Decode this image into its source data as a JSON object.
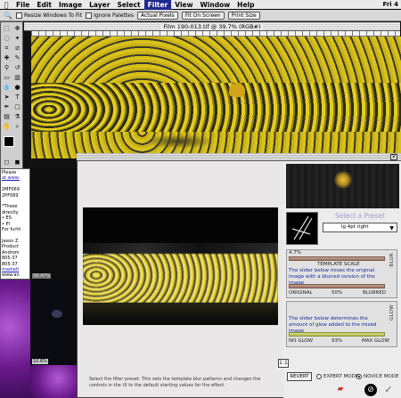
{
  "menubar": {
    "apple": "",
    "items": [
      "File",
      "Edit",
      "Image",
      "Layer",
      "Select",
      "Filter",
      "View",
      "Window",
      "Help"
    ],
    "active_index": 5,
    "clock": "Fri 4"
  },
  "options_bar": {
    "resize_windows": "Resize Windows To Fit",
    "ignore_palettes": "Ignore Palettes",
    "actual_pixels": "Actual Pixels",
    "fit_on_screen": "Fit On Screen",
    "print_size": "Print Size"
  },
  "document": {
    "title": "Film 190-013.tif @ 39.7% (RGB#)"
  },
  "left_window": {
    "lines": [
      "Please",
      "at www.",
      "",
      "2MF069",
      "2PF069",
      "",
      "*These",
      "directly",
      "• ES",
      "• Pl",
      "For furth",
      "",
      "Jason Z",
      "Product",
      "Androm",
      "805-37",
      "805-37",
      "marketi",
      "www.an"
    ],
    "zoom1": "39.47%",
    "zoom2": "10.6%"
  },
  "dialog": {
    "close": "✕",
    "preset_title": "Select a Preset",
    "preset_value": "lg 4pt right",
    "template_scale_value": "4.7%",
    "template_scale_label": "TEMPLATE SCALE",
    "blur_desc": "The slider below mixes the original image with a blurred version of the image",
    "blur_left": "ORIGINAL",
    "blur_mid": "50%",
    "blur_right": "BLURRED",
    "blur_side": "BLUR",
    "glow_desc": "The slider below determines the amount of glow added to the mixed image",
    "glow_left": "NO GLOW",
    "glow_mid": "93%",
    "glow_right": "MAX GLOW",
    "glow_side": "GLOW",
    "one_to_one": "1:1",
    "revert": "REVERT",
    "expert_mode": "EXPERT MODE",
    "novice_mode": "NOVICE MODE",
    "help_text": "Select the filter preset. This sets the template blur patterns and changes the controls in the UI to the default starting values for the effect."
  }
}
